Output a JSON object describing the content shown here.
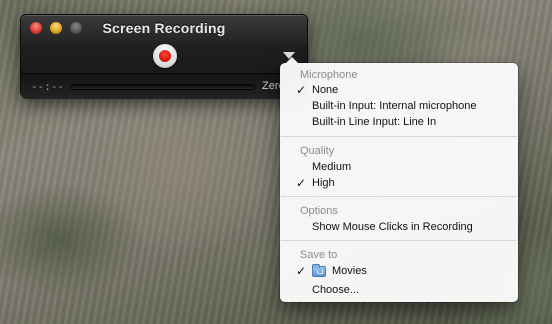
{
  "window": {
    "title": "Screen Recording",
    "elapsed_time": "--:--",
    "file_size": "Zero KB"
  },
  "menu": {
    "microphone": {
      "header": "Microphone",
      "items": [
        {
          "label": "None",
          "checked": true
        },
        {
          "label": "Built-in Input: Internal microphone",
          "checked": false
        },
        {
          "label": "Built-in Line Input: Line In",
          "checked": false
        }
      ]
    },
    "quality": {
      "header": "Quality",
      "items": [
        {
          "label": "Medium",
          "checked": false
        },
        {
          "label": "High",
          "checked": true
        }
      ]
    },
    "options": {
      "header": "Options",
      "items": [
        {
          "label": "Show Mouse Clicks in Recording",
          "checked": false
        }
      ]
    },
    "save_to": {
      "header": "Save to",
      "items": [
        {
          "label": "Movies",
          "checked": true,
          "icon": "folder-icon"
        },
        {
          "label": "Choose...",
          "checked": false
        }
      ]
    },
    "check_mark": "✓"
  },
  "colors": {
    "record_red": "#d0130a",
    "menu_background": "#fafafa",
    "header_gray": "#8c8c8c"
  }
}
